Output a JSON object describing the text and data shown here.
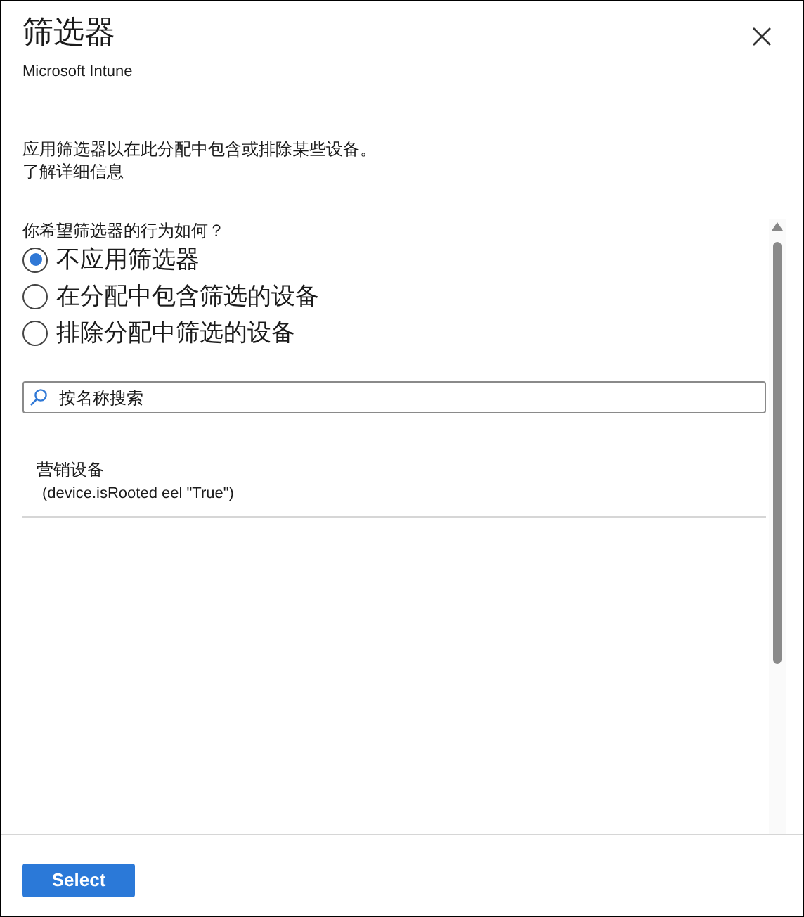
{
  "panel": {
    "title": "筛选器",
    "subtitle": "Microsoft Intune"
  },
  "description": "应用筛选器以在此分配中包含或排除某些设备。",
  "learn_more": "了解详细信息",
  "question": "你希望筛选器的行为如何？",
  "options": [
    {
      "label": "不应用筛选器",
      "selected": true
    },
    {
      "label": "在分配中包含筛选的设备",
      "selected": false
    },
    {
      "label": "排除分配中筛选的设备",
      "selected": false
    }
  ],
  "search": {
    "placeholder": "按名称搜索"
  },
  "filters": [
    {
      "name": "营销设备",
      "rule": "(device.isRooted eel \"True\")"
    }
  ],
  "buttons": [
    {
      "label": "Select"
    }
  ]
}
